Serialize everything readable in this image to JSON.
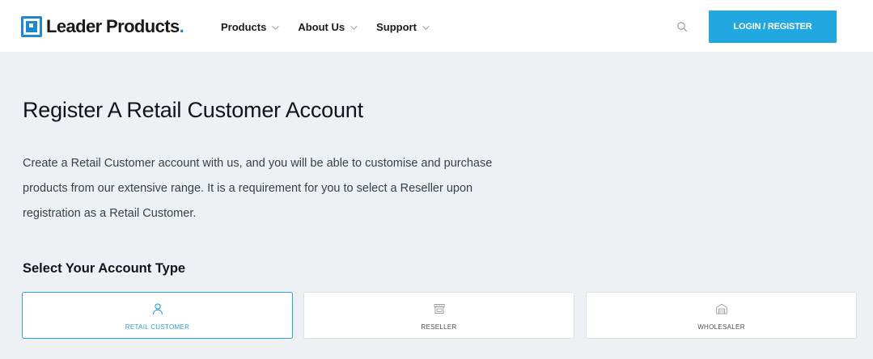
{
  "header": {
    "brand": {
      "name": "Leader Products",
      "dot": "."
    },
    "nav": [
      {
        "label": "Products"
      },
      {
        "label": "About Us"
      },
      {
        "label": "Support"
      }
    ],
    "search_icon": "search-icon",
    "login_label": "LOGIN / REGISTER"
  },
  "main": {
    "title": "Register A Retail Customer Account",
    "intro_lines": [
      "Create a Retail Customer account with us, and you will be able to customise and purchase",
      "products from our extensive range. It is a requirement for you to select a Reseller upon",
      "registration as a Retail Customer."
    ],
    "section_title": "Select Your Account Type",
    "account_types": [
      {
        "label": "RETAIL CUSTOMER",
        "icon": "user-icon",
        "selected": true
      },
      {
        "label": "RESELLER",
        "icon": "store-icon",
        "selected": false
      },
      {
        "label": "WHOLESALER",
        "icon": "warehouse-icon",
        "selected": false
      }
    ]
  },
  "colors": {
    "accent": "#21a8e0",
    "brand_blue": "#1e88d2",
    "background": "#eef1f4",
    "selected_border": "#2aa4dd"
  }
}
